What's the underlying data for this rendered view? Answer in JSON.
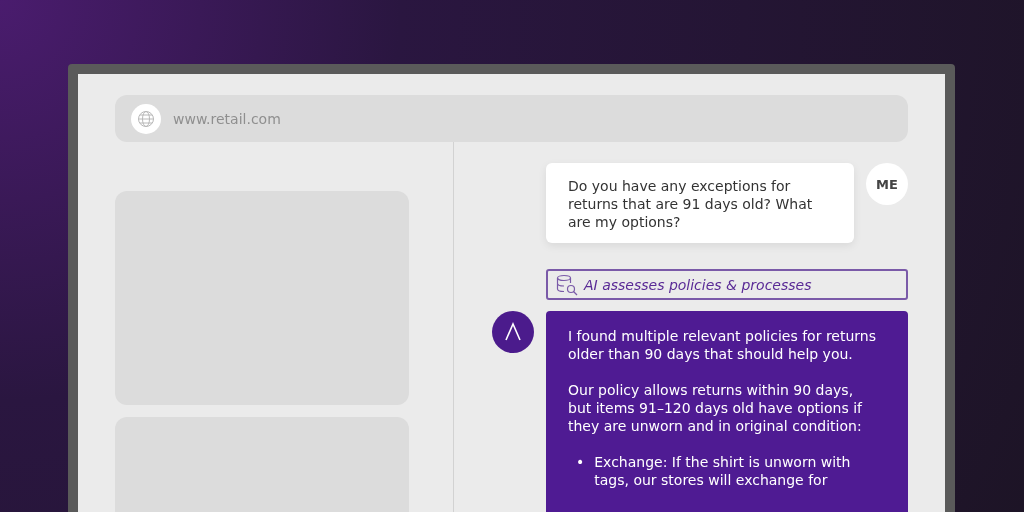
{
  "address_bar": {
    "url": "www.retail.com"
  },
  "chat": {
    "messages": [
      {
        "kind": "user",
        "avatar": "ME",
        "paragraphs": [
          "Do you have any exceptions for returns that are 91 days old? What are my options?"
        ]
      },
      {
        "kind": "status",
        "text": "AI assesses policies & processes"
      },
      {
        "kind": "assistant",
        "paragraphs": [
          "I found multiple relevant policies for returns older than 90 days that should help you.",
          "Our policy allows returns within 90 days, but items 91–120 days old have options if they are unworn and in original condition:"
        ],
        "bullets": [
          {
            "marker": "•",
            "text": "Exchange: If the shirt is unworn with tags, our stores will exchange for"
          }
        ]
      }
    ]
  }
}
